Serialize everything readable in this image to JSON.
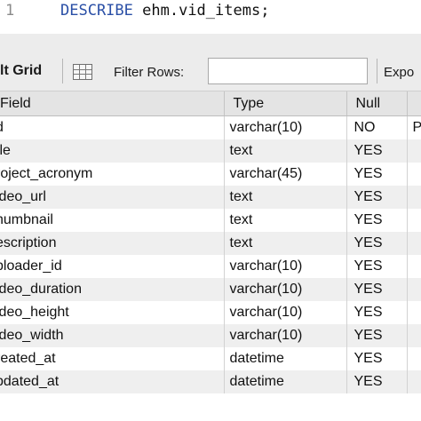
{
  "editor": {
    "line_number": "1",
    "keyword": "DESCRIBE",
    "statement_rest": "ehm.vid_items;"
  },
  "toolbar": {
    "grid_label": "lt Grid",
    "filter_label": "Filter Rows:",
    "filter_value": "",
    "export_label": "Expo"
  },
  "grid": {
    "columns": [
      "Field",
      "Type",
      "Null",
      ""
    ],
    "rows": [
      {
        "field": "d",
        "type": "varchar(10)",
        "null": "NO",
        "key": "P"
      },
      {
        "field": "tle",
        "type": "text",
        "null": "YES",
        "key": ""
      },
      {
        "field": "roject_acronym",
        "type": "varchar(45)",
        "null": "YES",
        "key": ""
      },
      {
        "field": "ideo_url",
        "type": "text",
        "null": "YES",
        "key": ""
      },
      {
        "field": "humbnail",
        "type": "text",
        "null": "YES",
        "key": ""
      },
      {
        "field": "escription",
        "type": "text",
        "null": "YES",
        "key": ""
      },
      {
        "field": "ploader_id",
        "type": "varchar(10)",
        "null": "YES",
        "key": ""
      },
      {
        "field": "ideo_duration",
        "type": "varchar(10)",
        "null": "YES",
        "key": ""
      },
      {
        "field": "ideo_height",
        "type": "varchar(10)",
        "null": "YES",
        "key": ""
      },
      {
        "field": "ideo_width",
        "type": "varchar(10)",
        "null": "YES",
        "key": ""
      },
      {
        "field": "reated_at",
        "type": "datetime",
        "null": "YES",
        "key": ""
      },
      {
        "field": "pdated_at",
        "type": "datetime",
        "null": "YES",
        "key": ""
      }
    ]
  }
}
